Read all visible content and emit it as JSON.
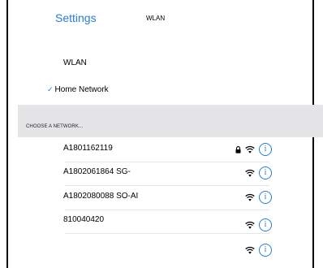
{
  "nav": {
    "back_label": "Settings",
    "title": "WLAN"
  },
  "wlan_row": {
    "label": "WLAN"
  },
  "connected": {
    "check": "✓",
    "name": "Home Network"
  },
  "section_header": "CHOOSE A NETWORK...",
  "networks": [
    {
      "ssid": "A1801162119",
      "locked": true,
      "info": "i"
    },
    {
      "ssid": "A1802061864 SG-",
      "locked": false,
      "info": "i"
    },
    {
      "ssid": "A1802080088 SO-AI",
      "locked": false,
      "info": "i"
    },
    {
      "ssid": "810040420",
      "locked": false,
      "info": "i"
    },
    {
      "ssid": "",
      "locked": false,
      "info": "i"
    }
  ],
  "colors": {
    "accent": "#2a7bd6",
    "section_bg": "#e5e5e8"
  }
}
